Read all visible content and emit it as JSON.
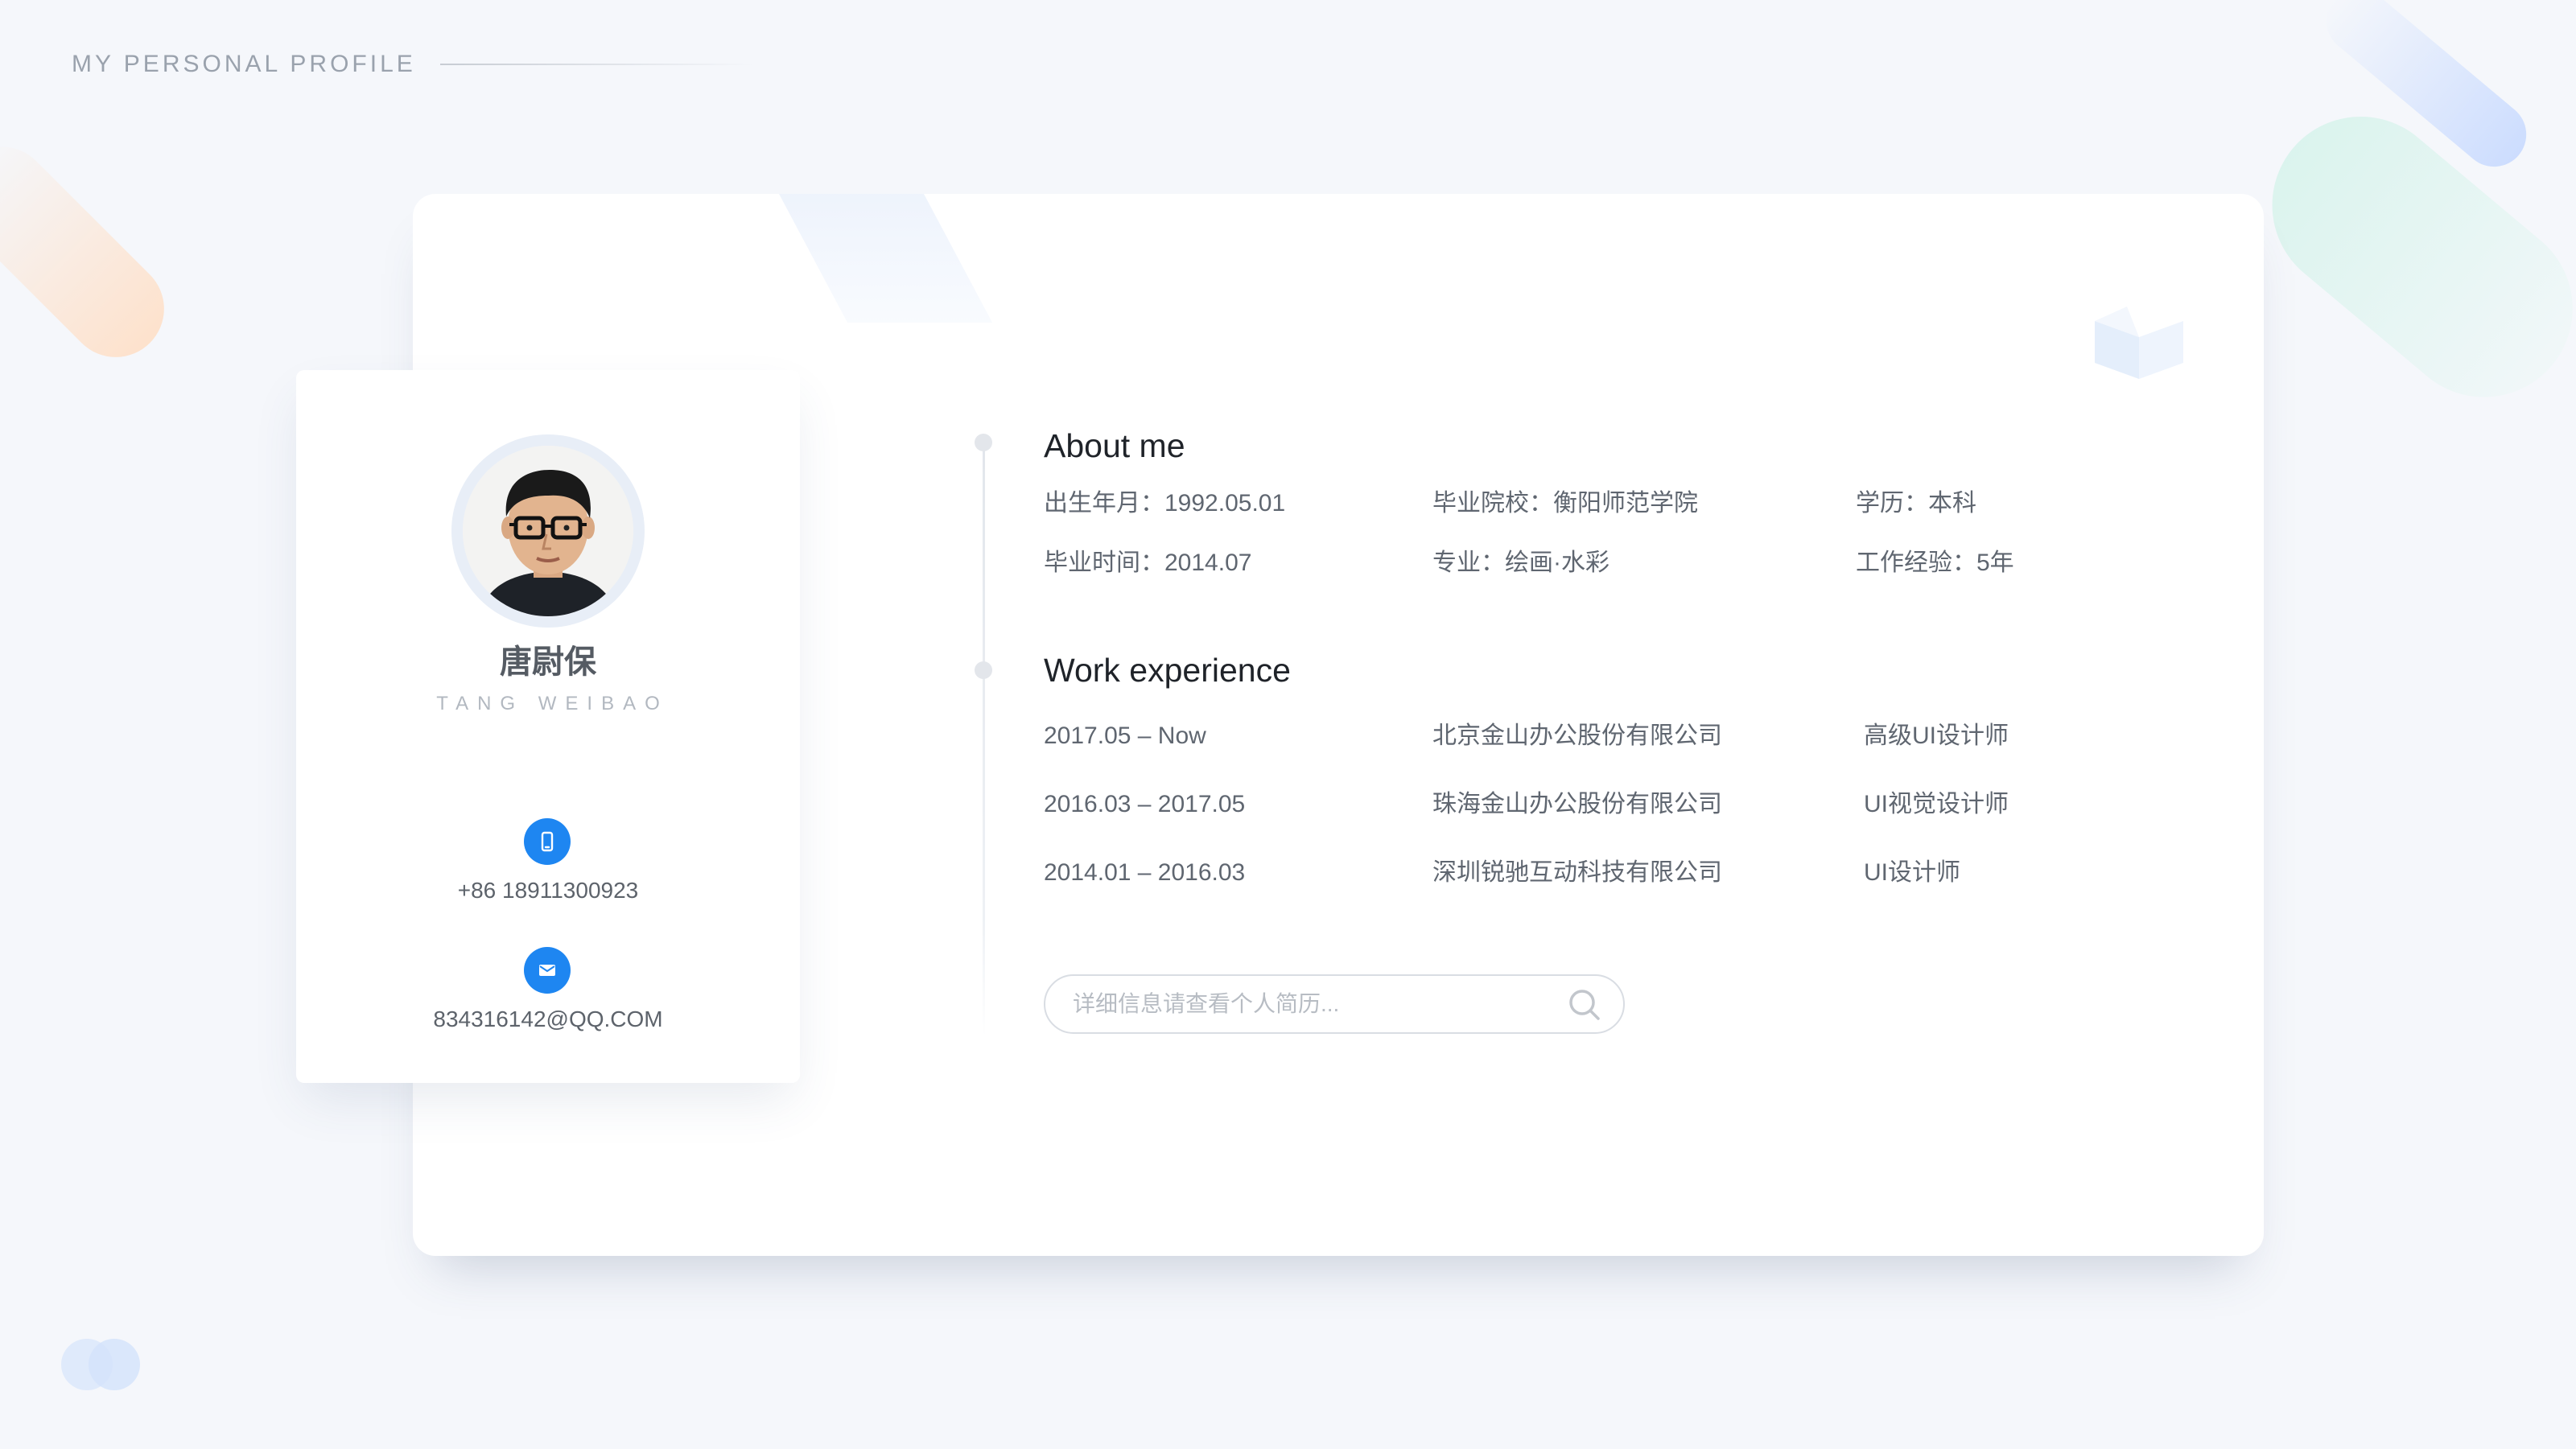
{
  "header": {
    "title": "MY PERSONAL PROFILE"
  },
  "profile": {
    "name_cn": "唐尉保",
    "name_en": "TANG WEIBAO",
    "phone": "+86 18911300923",
    "email": "834316142@QQ.COM",
    "phone_icon": "mobile-phone-icon",
    "email_icon": "envelope-icon"
  },
  "about": {
    "title": "About me",
    "rows": [
      [
        "出生年月：1992.05.01",
        "毕业院校：衡阳师范学院",
        "学历：本科"
      ],
      [
        "毕业时间：2014.07",
        "专业：绘画·水彩",
        "工作经验：5年"
      ]
    ]
  },
  "work": {
    "title": "Work experience",
    "items": [
      {
        "period": "2017.05 – Now",
        "company": "北京金山办公股份有限公司",
        "role": "高级UI设计师"
      },
      {
        "period": "2016.03 – 2017.05",
        "company": "珠海金山办公股份有限公司",
        "role": "UI视觉设计师"
      },
      {
        "period": "2014.01 – 2016.03",
        "company": "深圳锐驰互动科技有限公司",
        "role": "UI设计师"
      }
    ]
  },
  "search": {
    "placeholder": "详细信息请查看个人简历...",
    "icon": "search-icon"
  },
  "colors": {
    "accent": "#1e86f1",
    "background": "#f5f7fb",
    "card": "#ffffff"
  }
}
